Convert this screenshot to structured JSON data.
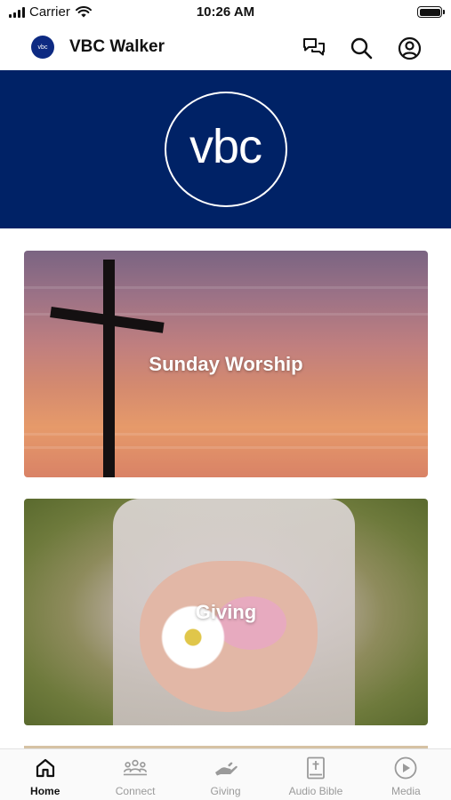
{
  "status_bar": {
    "carrier": "Carrier",
    "time": "10:26 AM"
  },
  "header": {
    "logo_text": "vbc",
    "title": "VBC Walker",
    "icons": [
      "chat-icon",
      "search-icon",
      "account-icon"
    ]
  },
  "banner": {
    "logo_text": "vbc",
    "background": "#002266"
  },
  "cards": [
    {
      "label": "Sunday Worship"
    },
    {
      "label": "Giving"
    }
  ],
  "tabs": [
    {
      "label": "Home",
      "icon": "home-icon",
      "active": true
    },
    {
      "label": "Connect",
      "icon": "people-icon",
      "active": false
    },
    {
      "label": "Giving",
      "icon": "hand-icon",
      "active": false
    },
    {
      "label": "Audio Bible",
      "icon": "bible-icon",
      "active": false
    },
    {
      "label": "Media",
      "icon": "play-circle-icon",
      "active": false
    }
  ],
  "colors": {
    "brand": "#002266",
    "tab_active": "#111111",
    "tab_inactive": "#9a9a9a"
  }
}
